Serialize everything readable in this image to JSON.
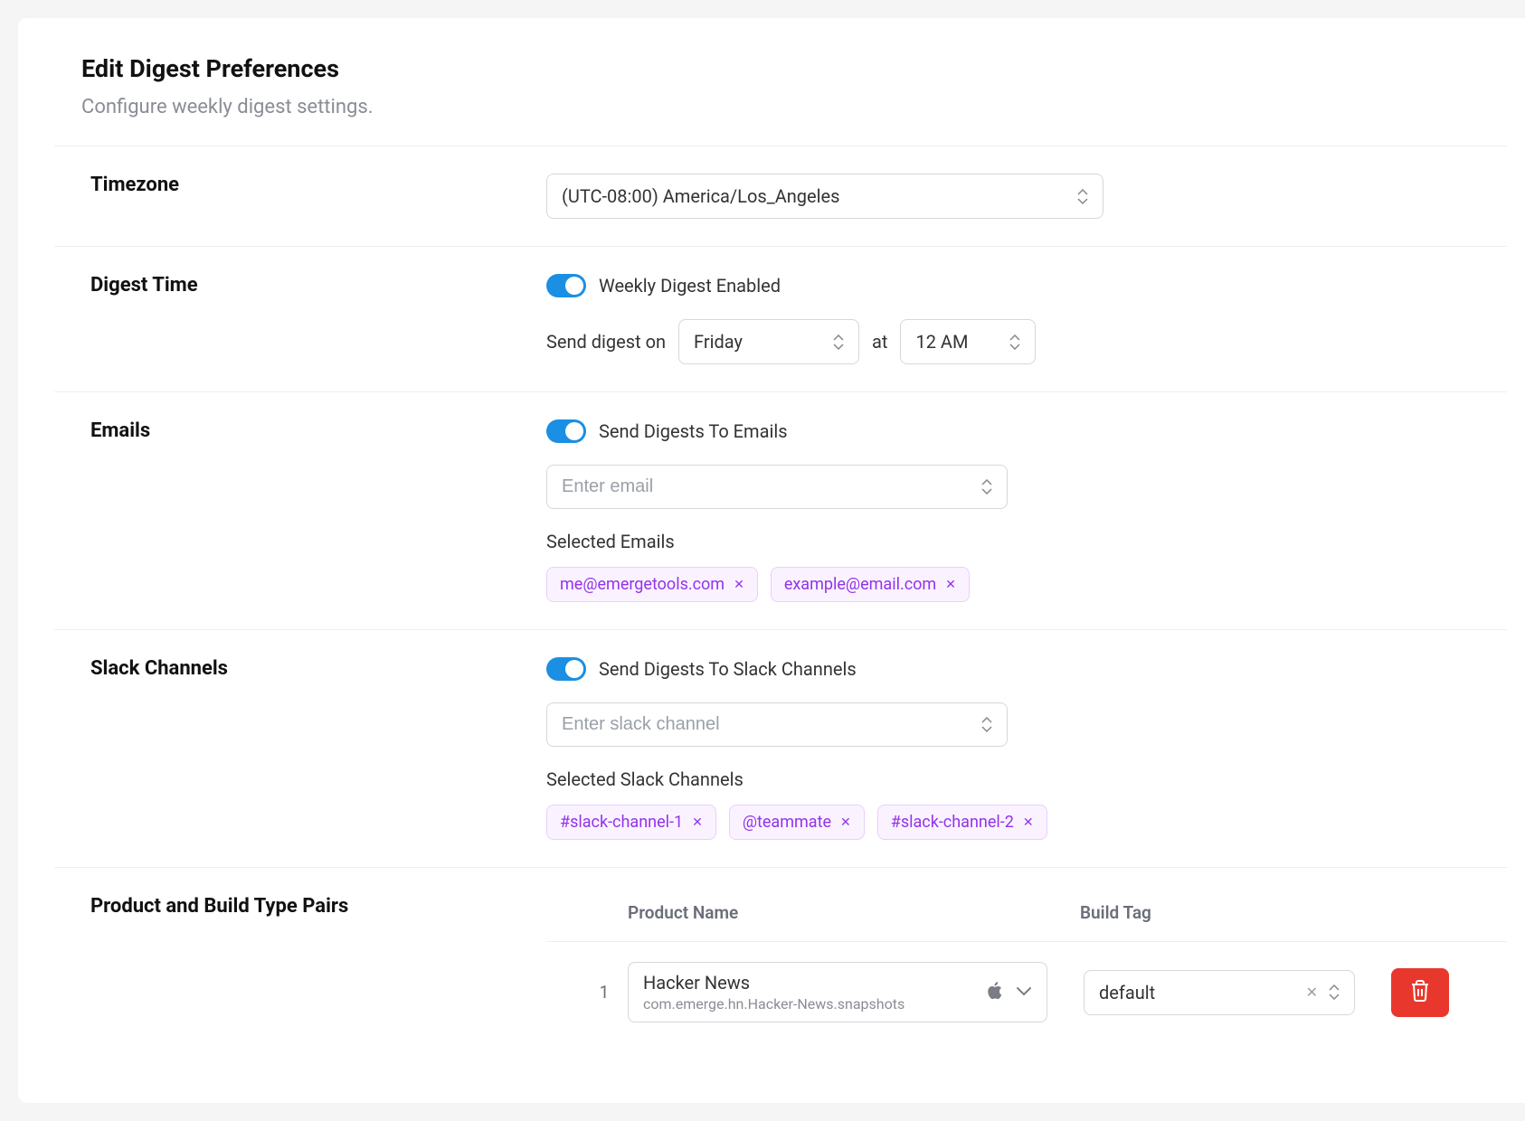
{
  "header": {
    "title": "Edit Digest Preferences",
    "subtitle": "Configure weekly digest settings."
  },
  "timezone": {
    "label": "Timezone",
    "value": "(UTC-08:00) America/Los_Angeles"
  },
  "digestTime": {
    "label": "Digest Time",
    "toggleLabel": "Weekly Digest Enabled",
    "sendPrefix": "Send digest on",
    "day": "Friday",
    "atLabel": "at",
    "hour": "12 AM"
  },
  "emails": {
    "label": "Emails",
    "toggleLabel": "Send Digests To Emails",
    "placeholder": "Enter email",
    "selectedLabel": "Selected Emails",
    "items": [
      "me@emergetools.com",
      "example@email.com"
    ]
  },
  "slack": {
    "label": "Slack Channels",
    "toggleLabel": "Send Digests To Slack Channels",
    "placeholder": "Enter slack channel",
    "selectedLabel": "Selected Slack Channels",
    "items": [
      "#slack-channel-1",
      "@teammate",
      "#slack-channel-2"
    ]
  },
  "products": {
    "label": "Product and Build Type Pairs",
    "headers": {
      "product": "Product Name",
      "build": "Build Tag"
    },
    "rows": [
      {
        "index": "1",
        "name": "Hacker News",
        "id": "com.emerge.hn.Hacker-News.snapshots",
        "buildTag": "default"
      }
    ]
  }
}
